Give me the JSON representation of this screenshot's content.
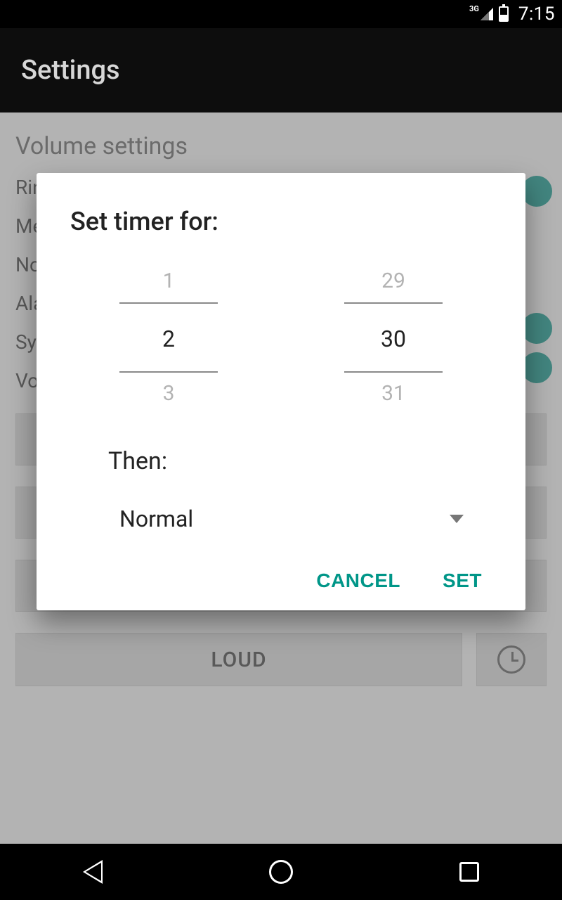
{
  "status": {
    "network": "3G",
    "time": "7:15"
  },
  "appbar": {
    "title": "Settings"
  },
  "page": {
    "section_title": "Volume settings",
    "rows": [
      "Rin",
      "Me",
      "No",
      "Ala",
      "Sy",
      "Vo"
    ],
    "loud_label": "LOUD"
  },
  "dialog": {
    "title": "Set timer for:",
    "picker1": {
      "above": "1",
      "value": "2",
      "below": "3"
    },
    "picker2": {
      "above": "29",
      "value": "30",
      "below": "31"
    },
    "then_label": "Then:",
    "dropdown_value": "Normal",
    "cancel": "CANCEL",
    "set": "SET"
  }
}
